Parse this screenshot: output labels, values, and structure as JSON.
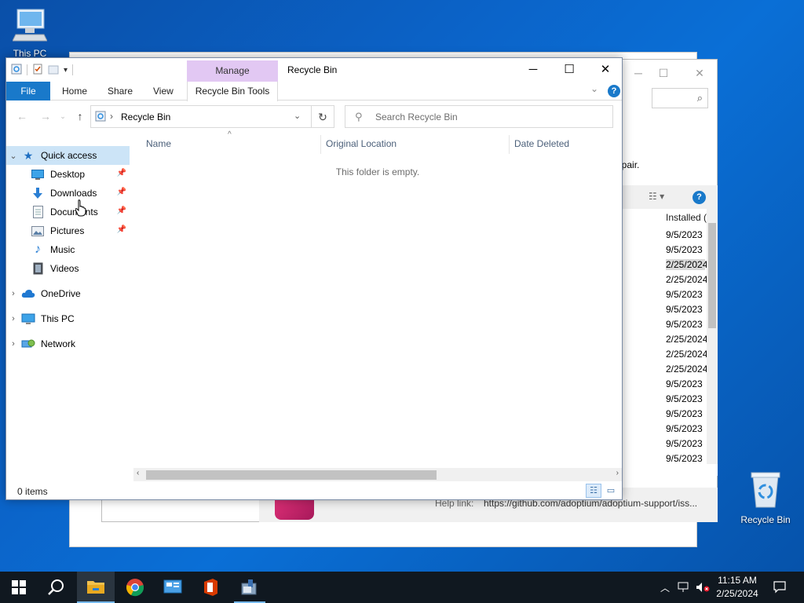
{
  "desktop": {
    "icons": [
      {
        "label": "This PC",
        "icon": "this-pc-icon"
      },
      {
        "label": "Recycle Bin",
        "icon": "recycle-bin-icon"
      }
    ]
  },
  "background_window": {
    "repair_text": "epair.",
    "column_header": "Installed (",
    "rows": [
      "9/5/2023",
      "9/5/2023",
      "2/25/2024",
      "2/25/2024",
      "9/5/2023",
      "9/5/2023",
      "9/5/2023",
      "2/25/2024",
      "2/25/2024",
      "2/25/2024",
      "9/5/2023",
      "9/5/2023",
      "9/5/2023",
      "9/5/2023",
      "9/5/2023",
      "9/5/2023"
    ],
    "help_label": "Help link:",
    "help_link": "https://github.com/adoptium/adoptium-support/iss..."
  },
  "explorer": {
    "title": "Recycle Bin",
    "manage_tab": "Manage",
    "ribbon_tabs": {
      "file": "File",
      "home": "Home",
      "share": "Share",
      "view": "View",
      "recycle_bin_tools": "Recycle Bin Tools"
    },
    "address": {
      "crumb": "Recycle Bin"
    },
    "search": {
      "placeholder": "Search Recycle Bin"
    },
    "nav": {
      "quick_access": "Quick access",
      "quick_items": [
        {
          "label": "Desktop",
          "pinned": true
        },
        {
          "label": "Downloads",
          "pinned": true
        },
        {
          "label": "Documents",
          "pinned": true
        },
        {
          "label": "Pictures",
          "pinned": true
        },
        {
          "label": "Music",
          "pinned": false
        },
        {
          "label": "Videos",
          "pinned": false
        }
      ],
      "roots": [
        "OneDrive",
        "This PC",
        "Network"
      ]
    },
    "columns": [
      "Name",
      "Original Location",
      "Date Deleted"
    ],
    "empty_message": "This folder is empty.",
    "status": "0 items"
  },
  "taskbar": {
    "apps": [
      "start-icon",
      "search-icon",
      "file-explorer-icon",
      "chrome-icon",
      "control-panel-icon",
      "office-icon",
      "installer-icon"
    ],
    "time": "11:15 AM",
    "date": "2/25/2024"
  },
  "colors": {
    "accent": "#1979ca",
    "manage_tab": "#e2c8f3",
    "selection": "#cce4f7",
    "taskbar": "#101820"
  }
}
